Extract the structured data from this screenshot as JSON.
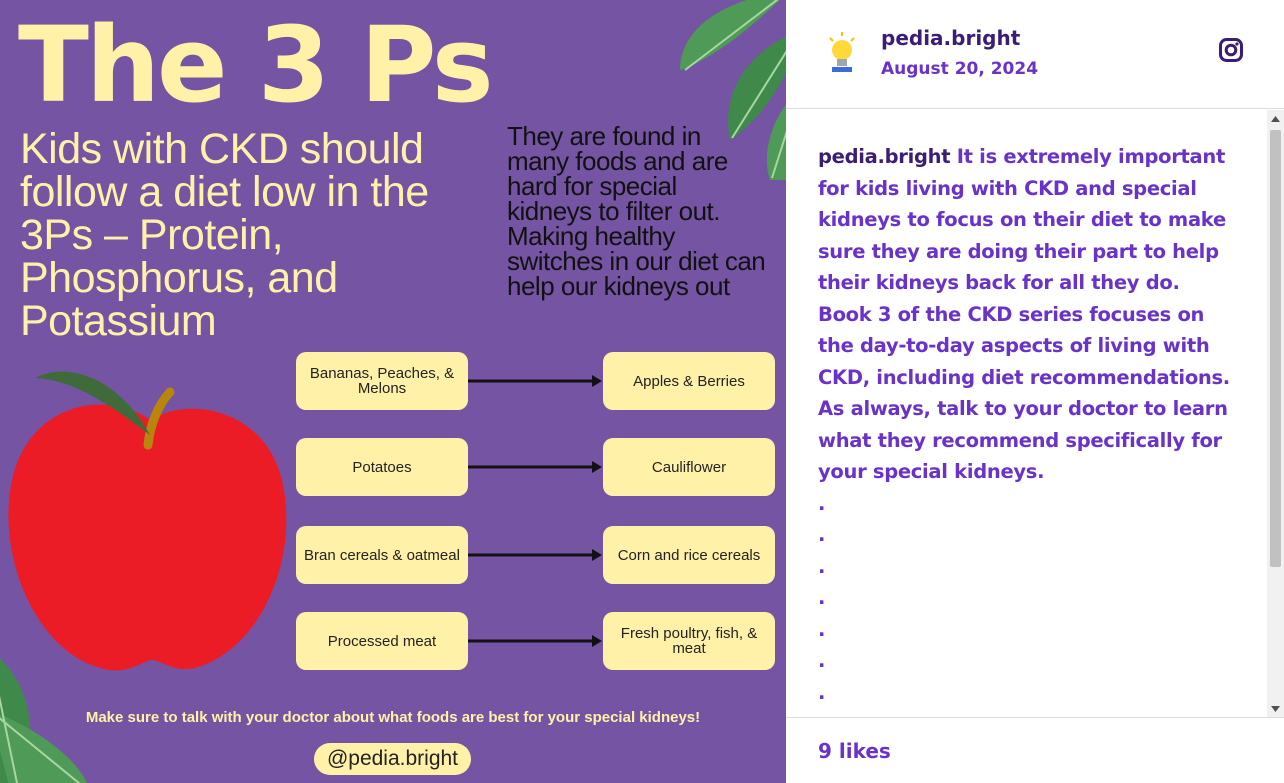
{
  "poster": {
    "title": "The 3 Ps",
    "subtitle": "Kids with CKD should follow a diet low in the 3Ps – Protein, Phosphorus, and Potassium",
    "side_text": "They are found in many foods and are hard for special kidneys to filter out. Making healthy switches in our diet can help our kidneys out",
    "swaps": [
      {
        "from": "Bananas, Peaches, & Melons",
        "to": "Apples & Berries"
      },
      {
        "from": "Potatoes",
        "to": "Cauliflower"
      },
      {
        "from": "Bran cereals & oatmeal",
        "to": "Corn and rice cereals"
      },
      {
        "from": "Processed meat",
        "to": "Fresh poultry, fish, & meat"
      }
    ],
    "footer_note": "Make sure to talk with your doctor about what foods are best for your special kidneys!",
    "handle": "@pedia.bright",
    "colors": {
      "background": "#7554a3",
      "accent_yellow": "#fff2a8",
      "apple_red": "#ec1c27",
      "leaf_green": "#3f8a4a"
    }
  },
  "post": {
    "username": "pedia.bright",
    "date": "August 20, 2024",
    "caption_user": "pedia.bright",
    "caption_p1": "It is extremely important for kids living with CKD and special kidneys to focus on their diet to make sure they are doing their part to help their kidneys back for all they do. Book 3 of the CKD series focuses on the day-to-day aspects of living with CKD, including diet recommendations.",
    "caption_p2": "As always, talk to your doctor to learn what they recommend specifically for your special kidneys.",
    "dots": [
      ".",
      ".",
      ".",
      ".",
      ".",
      ".",
      "."
    ],
    "likes": "9 likes",
    "icons": {
      "avatar": "lightbulb-avatar-icon",
      "platform": "instagram-icon"
    },
    "colors": {
      "username": "#3b1d78",
      "text": "#6a32c9"
    }
  }
}
